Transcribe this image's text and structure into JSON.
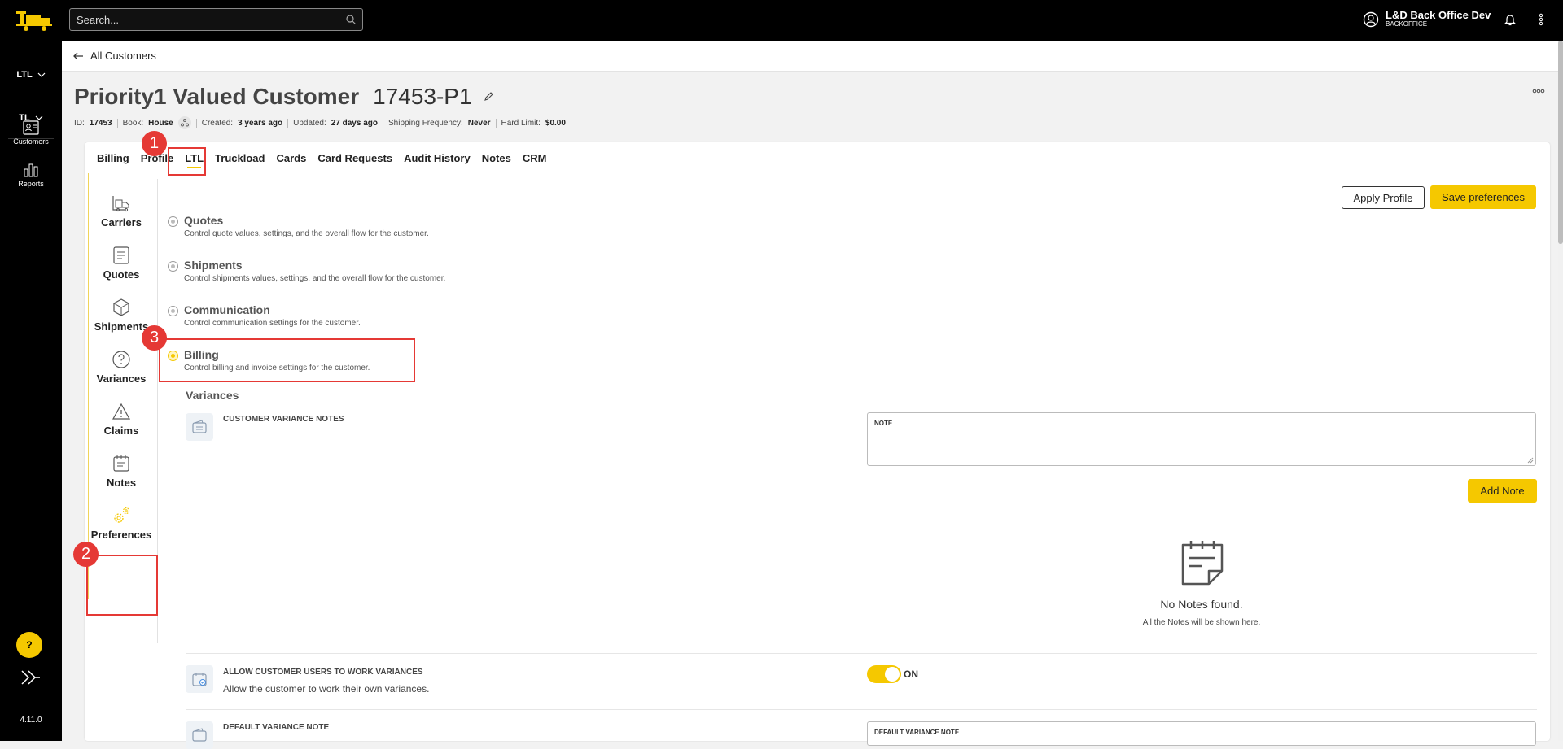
{
  "topbar": {
    "search_placeholder": "Search...",
    "user_name": "L&D Back Office Dev",
    "user_role": "BACKOFFICE"
  },
  "leftnav": {
    "selector_ltl": "LTL",
    "selector_tl": "TL",
    "items": [
      {
        "label": "Customers",
        "icon": "customers-icon"
      },
      {
        "label": "Reports",
        "icon": "reports-icon"
      }
    ],
    "help_label": "?",
    "version": "4.11.0"
  },
  "breadcrumb": {
    "back_label": "All Customers"
  },
  "header": {
    "customer_name": "Priority1 Valued Customer",
    "account_code": "17453-P1",
    "meta": {
      "id_label": "ID:",
      "id_value": "17453",
      "book_label": "Book:",
      "book_value": "House",
      "created_label": "Created:",
      "created_value": "3 years ago",
      "updated_label": "Updated:",
      "updated_value": "27 days ago",
      "frequency_label": "Shipping Frequency:",
      "frequency_value": "Never",
      "limit_label": "Hard Limit:",
      "limit_value": "$0.00"
    }
  },
  "tabs": [
    "Billing",
    "Profile",
    "LTL",
    "Truckload",
    "Cards",
    "Card Requests",
    "Audit History",
    "Notes",
    "CRM"
  ],
  "active_tab": "LTL",
  "pref_nav": [
    "Carriers",
    "Quotes",
    "Shipments",
    "Variances",
    "Claims",
    "Notes",
    "Preferences"
  ],
  "actions": {
    "apply_profile": "Apply Profile",
    "save_preferences": "Save preferences"
  },
  "steps": [
    {
      "title": "Quotes",
      "desc": "Control quote values, settings, and the overall flow for the customer."
    },
    {
      "title": "Shipments",
      "desc": "Control shipments values, settings, and the overall flow for the customer."
    },
    {
      "title": "Communication",
      "desc": "Control communication settings for the customer."
    },
    {
      "title": "Billing",
      "desc": "Control billing and invoice settings for the customer."
    }
  ],
  "variances": {
    "heading": "Variances",
    "notes_label": "CUSTOMER VARIANCE NOTES",
    "note_field_label": "NOTE",
    "add_note": "Add Note",
    "empty_title": "No Notes found.",
    "empty_sub": "All the Notes will be shown here.",
    "allow_label": "ALLOW CUSTOMER USERS TO WORK VARIANCES",
    "allow_desc": "Allow the customer to work their own variances.",
    "allow_state": "ON",
    "default_label": "DEFAULT VARIANCE NOTE",
    "default_field_label": "DEFAULT VARIANCE NOTE"
  },
  "annotations": [
    "1",
    "2",
    "3"
  ],
  "colors": {
    "accent": "#f5c800",
    "annotation": "#e53935"
  }
}
